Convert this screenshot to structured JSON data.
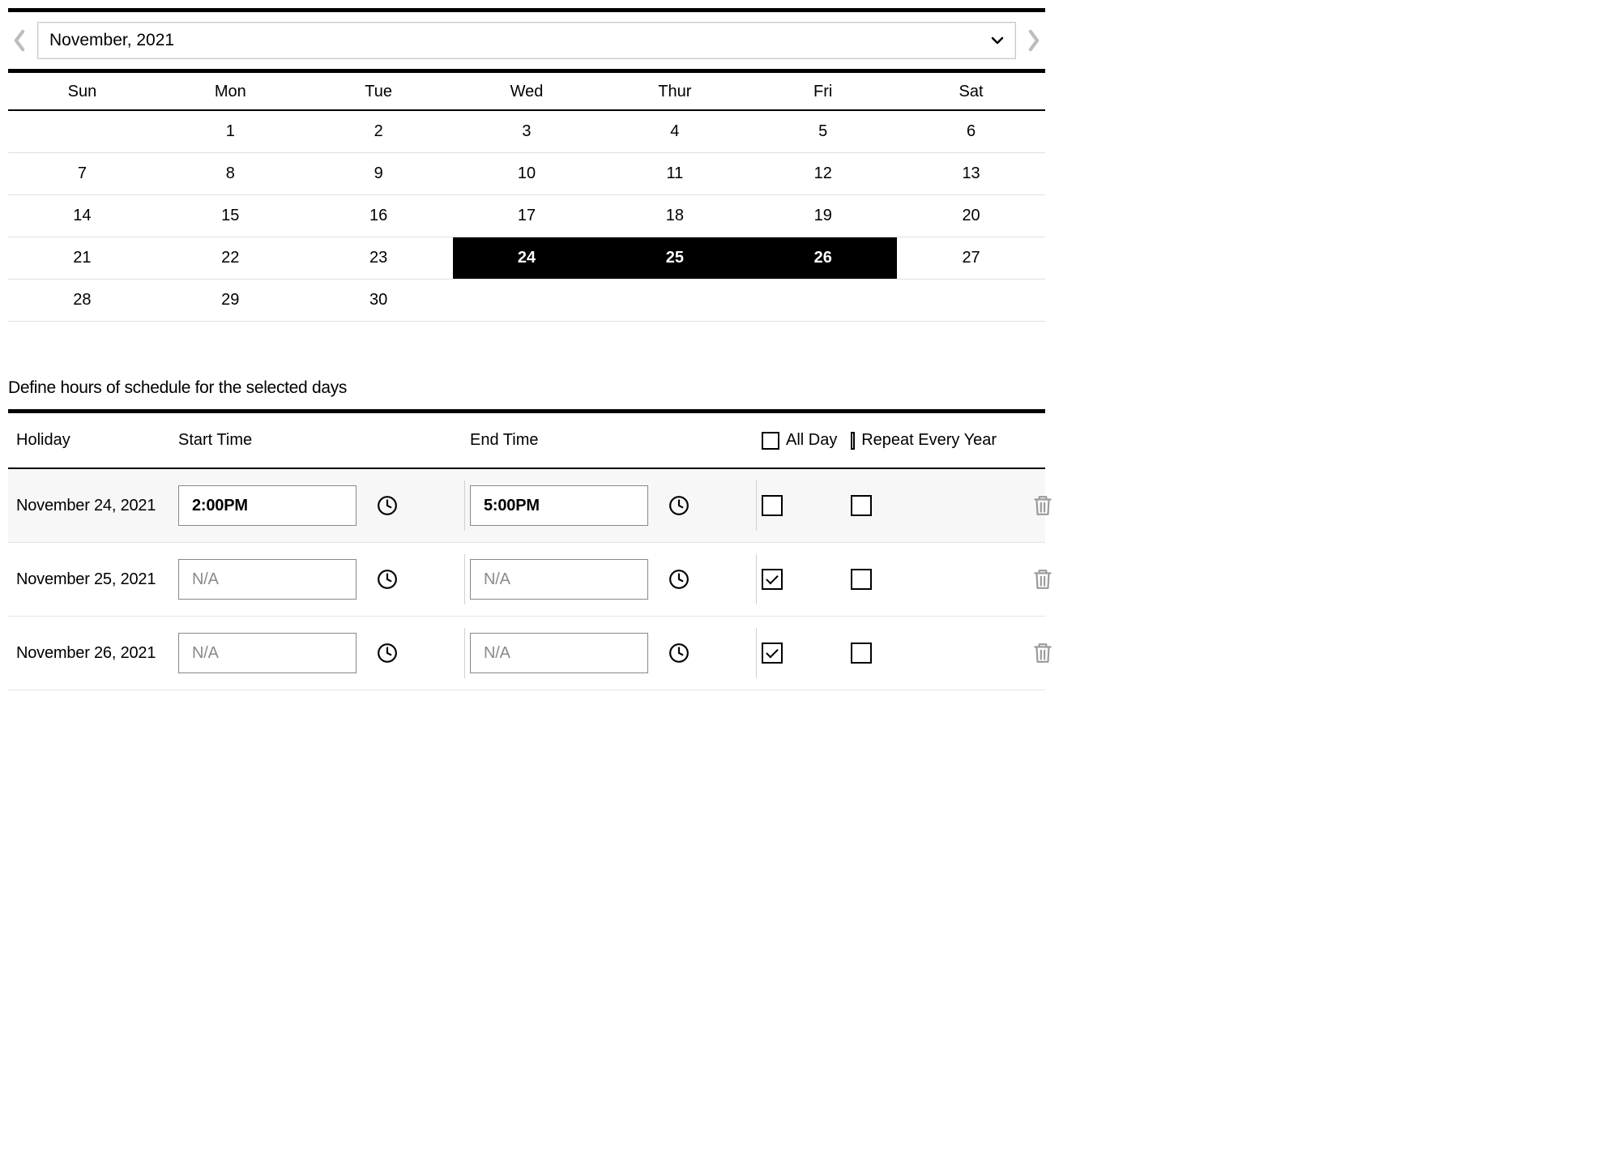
{
  "month_selector": {
    "label": "November, 2021"
  },
  "calendar": {
    "day_headers": [
      "Sun",
      "Mon",
      "Tue",
      "Wed",
      "Thur",
      "Fri",
      "Sat"
    ],
    "weeks": [
      [
        null,
        1,
        2,
        3,
        4,
        5,
        6
      ],
      [
        7,
        8,
        9,
        10,
        11,
        12,
        13
      ],
      [
        14,
        15,
        16,
        17,
        18,
        19,
        20
      ],
      [
        21,
        22,
        23,
        24,
        25,
        26,
        27
      ],
      [
        28,
        29,
        30,
        null,
        null,
        null,
        null
      ]
    ],
    "selected_days": [
      24,
      25,
      26
    ]
  },
  "section_title": "Define hours of schedule for the selected days",
  "columns": {
    "holiday": "Holiday",
    "start_time": "Start Time",
    "end_time": "End Time",
    "all_day": "All Day",
    "repeat": "Repeat Every Year"
  },
  "placeholder": "N/A",
  "rows": [
    {
      "holiday": "November 24, 2021",
      "start": "2:00PM",
      "end": "5:00PM",
      "all_day": false,
      "repeat": false,
      "shade": true
    },
    {
      "holiday": "November 25, 2021",
      "start": "",
      "end": "",
      "all_day": true,
      "repeat": false,
      "shade": false
    },
    {
      "holiday": "November 26, 2021",
      "start": "",
      "end": "",
      "all_day": true,
      "repeat": false,
      "shade": false
    }
  ]
}
